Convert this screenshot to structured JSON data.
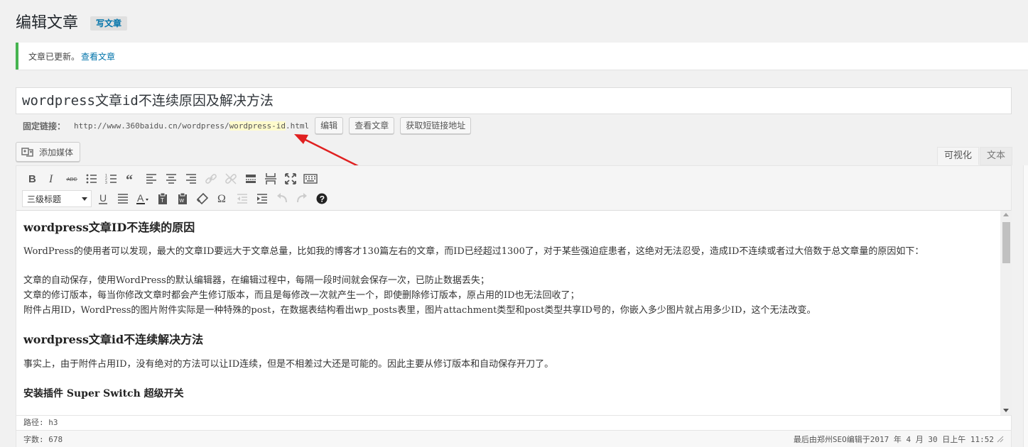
{
  "header": {
    "title": "编辑文章",
    "add_new": "写文章"
  },
  "notice": {
    "message": "文章已更新。",
    "link": "查看文章"
  },
  "post": {
    "title": "wordpress文章id不连续原因及解决方法"
  },
  "permalink": {
    "label": "固定链接：",
    "base": "http://www.360baidu.cn/wordpress/",
    "slug": "wordpress-id",
    "ext": ".html",
    "edit_btn": "编辑",
    "view_btn": "查看文章",
    "shortlink_btn": "获取短链接地址"
  },
  "editor": {
    "add_media": "添加媒体",
    "tab_visual": "可视化",
    "tab_text": "文本",
    "format_select": "三级标题",
    "toolbar_row1": [
      "bold-icon",
      "italic-icon",
      "strikethrough-icon",
      "bullet-list-icon",
      "numbered-list-icon",
      "blockquote-icon",
      "align-left-icon",
      "align-center-icon",
      "align-right-icon",
      "insert-link-icon",
      "remove-link-icon",
      "read-more-icon",
      "page-break-icon",
      "fullscreen-icon",
      "toolbar-toggle-icon"
    ],
    "toolbar_row2": [
      "underline-icon",
      "justify-icon",
      "text-color-icon",
      "paste-text-icon",
      "paste-word-icon",
      "clear-formatting-icon",
      "special-character-icon",
      "outdent-icon",
      "indent-icon",
      "undo-icon",
      "redo-icon",
      "help-icon"
    ],
    "content": {
      "h1": "wordpress文章ID不连续的原因",
      "p1": "WordPress的使用者可以发现，最大的文章ID要远大于文章总量，比如我的博客才130篇左右的文章，而ID已经超过1300了，对于某些强迫症患者，这绝对无法忍受，造成ID不连续或者过大倍数于总文章量的原因如下：",
      "line1": "文章的自动保存，使用WordPress的默认编辑器，在编辑过程中，每隔一段时间就会保存一次，已防止数据丢失；",
      "line2": "文章的修订版本，每当你修改文章时都会产生修订版本，而且是每修改一次就产生一个，即使删除修订版本，原占用的ID也无法回收了；",
      "line3": "附件占用ID，WordPress的图片附件实际是一种特殊的post，在数据表结构看出wp_posts表里，图片attachment类型和post类型共享ID号的，你嵌入多少图片就占用多少ID，这个无法改变。",
      "h2": "wordpress文章id不连续解决方法",
      "p2": "事实上，由于附件占用ID，没有绝对的方法可以让ID连续，但是不相差过大还是可能的。因此主要从修订版本和自动保存开刀了。",
      "h3": "安装插件 Super Switch 超级开关"
    },
    "path": "路径: h3",
    "word_count": "字数: 678",
    "last_edited": "最后由郑州SEO编辑于2017 年 4 月 30 日上午 11:52"
  },
  "colors": {
    "accent": "#0073aa",
    "success": "#46b450",
    "annotation_arrow": "#e02020",
    "slug_highlight": "#fffbcc"
  }
}
